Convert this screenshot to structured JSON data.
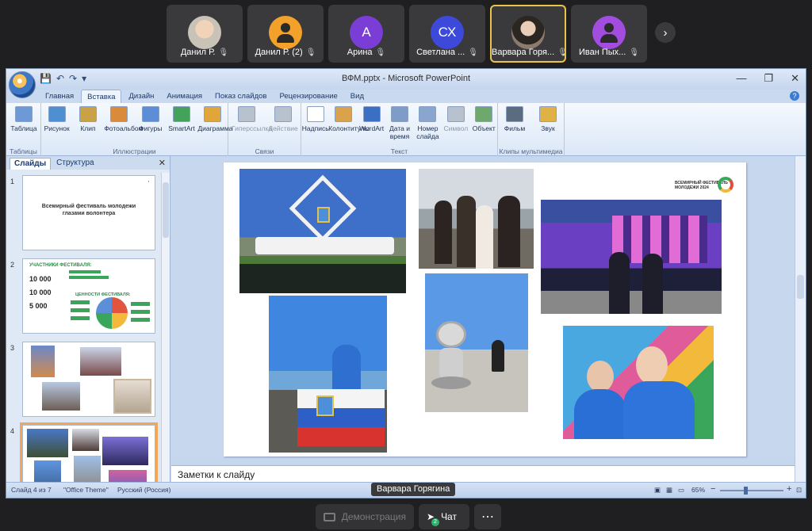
{
  "participants": [
    {
      "name": "Данил Р.",
      "kind": "photo1"
    },
    {
      "name": "Данил Р. (2)",
      "kind": "icon",
      "color": "#f2a22a"
    },
    {
      "name": "Арина",
      "kind": "initial",
      "initial": "А",
      "color": "#7a3dd6"
    },
    {
      "name": "Светлана ...",
      "kind": "initial",
      "initial": "СХ",
      "color": "#3c49d9"
    },
    {
      "name": "Варвара Горя...",
      "kind": "photo2",
      "active": true
    },
    {
      "name": "Иван Пых...",
      "kind": "icon",
      "color": "#a24ce0"
    }
  ],
  "mic_glyph": "🎙",
  "next_glyph": "›",
  "window": {
    "title": "ВФМ.pptx - Microsoft PowerPoint",
    "qat": [
      "💾",
      "↶",
      "↷",
      "▾"
    ],
    "controls": [
      "—",
      "❐",
      "✕"
    ]
  },
  "tabs": [
    "Главная",
    "Вставка",
    "Дизайн",
    "Анимация",
    "Показ слайдов",
    "Рецензирование",
    "Вид"
  ],
  "active_tab": "Вставка",
  "help": "?",
  "ribbon": {
    "buttons": [
      {
        "label": "Таблица",
        "color": "#6d9ad6",
        "dim": false
      },
      {
        "label": "Рисунок",
        "color": "#4f8fd1",
        "dim": false
      },
      {
        "label": "Клип",
        "color": "#c9a247",
        "dim": false
      },
      {
        "label": "Фотоальбом",
        "color": "#d98a3b",
        "dim": false
      },
      {
        "label": "Фигуры",
        "color": "#5b8ed6",
        "dim": false
      },
      {
        "label": "SmartArt",
        "color": "#43a35a",
        "dim": false
      },
      {
        "label": "Диаграмма",
        "color": "#e0a63a",
        "dim": false
      },
      {
        "label": "Гиперссылка",
        "color": "#b8c2cf",
        "dim": true
      },
      {
        "label": "Действие",
        "color": "#b8c2cf",
        "dim": true
      },
      {
        "label": "Надпись",
        "color": "#ffffff",
        "dim": false
      },
      {
        "label": "Колонтитулы",
        "color": "#d9a24b",
        "dim": false
      },
      {
        "label": "WordArt",
        "color": "#3a6fc4",
        "dim": false
      },
      {
        "label": "Дата и время",
        "color": "#7e9cc7",
        "dim": false
      },
      {
        "label": "Номер слайда",
        "color": "#8aa6cf",
        "dim": false
      },
      {
        "label": "Символ",
        "color": "#b8c2cf",
        "dim": true
      },
      {
        "label": "Объект",
        "color": "#6ea86c",
        "dim": false
      },
      {
        "label": "Фильм",
        "color": "#5b6b80",
        "dim": false
      },
      {
        "label": "Звук",
        "color": "#e0b245",
        "dim": false
      }
    ],
    "groups": [
      "Таблицы",
      "Иллюстрации",
      "Связи",
      "Текст",
      "Клипы мультимедиа"
    ]
  },
  "slides_pane": {
    "tabs": [
      "Слайды",
      "Структура"
    ],
    "close": "✕",
    "thumbnails": [
      {
        "num": "1",
        "title": "Всемирный фестиваль молодежи глазами волонтера"
      },
      {
        "num": "2",
        "heading1": "УЧАСТНИКИ ФЕСТИВАЛЯ:",
        "heading2": "ЦЕННОСТИ ФЕСТИВАЛЯ:",
        "stats": [
          "10 000",
          "10 000",
          "5 000"
        ]
      },
      {
        "num": "3"
      },
      {
        "num": "4"
      }
    ]
  },
  "notes_placeholder": "Заметки к слайду",
  "status": {
    "slide": "Слайд 4 из 7",
    "theme": "\"Office Theme\"",
    "lang": "Русский (Россия)",
    "zoom": "65%",
    "minus": "−",
    "plus": "+"
  },
  "presenter": "Варвара Горягина",
  "bottom": {
    "demo": "Демонстрация",
    "chat": "Чат",
    "chat_badge": "2",
    "more": "⋯"
  }
}
